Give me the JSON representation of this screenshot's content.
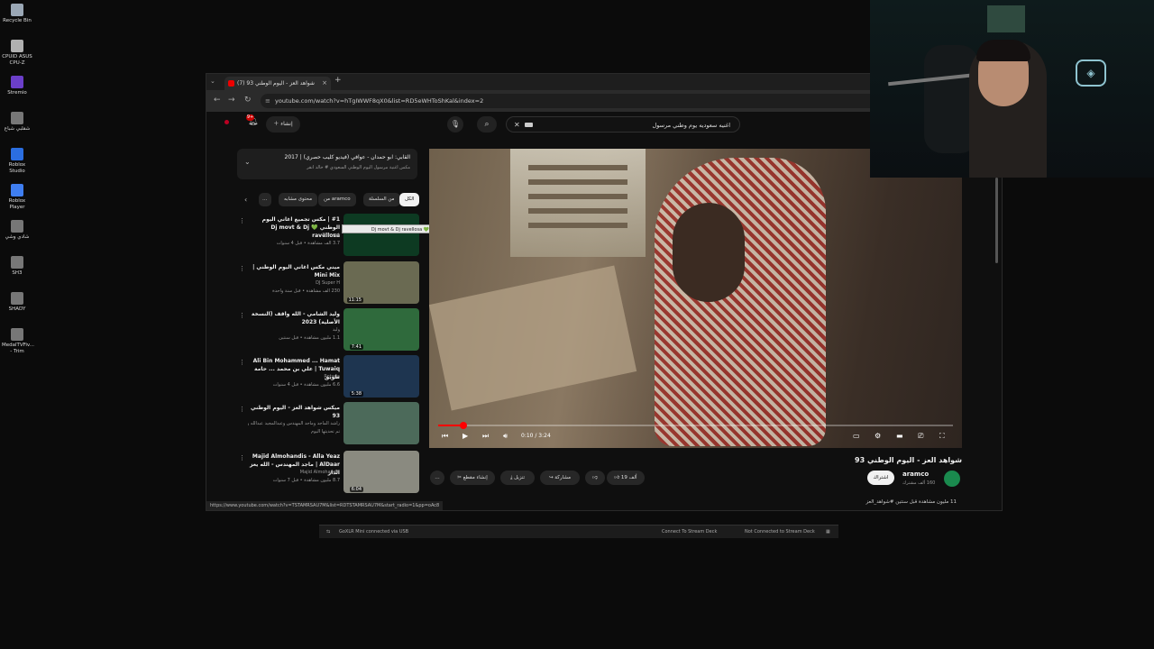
{
  "desktop": {
    "icons": [
      {
        "label": "Recycle Bin",
        "color": "#9aa7b5"
      },
      {
        "label": "CPUID ASUS CPU-Z",
        "color": "#b0b0b0"
      },
      {
        "label": "Stremio",
        "color": "#6b3fc9"
      },
      {
        "label": "شقلبي شباع",
        "color": "#777777"
      },
      {
        "label": "Roblox Studio",
        "color": "#2b6ee0"
      },
      {
        "label": "Roblox Player",
        "color": "#3f7ef0"
      },
      {
        "label": "شادي وشي",
        "color": "#777777"
      },
      {
        "label": "SH3",
        "color": "#777777"
      },
      {
        "label": "SHADY",
        "color": "#777777"
      },
      {
        "label": "MedalTVFiv... - Trim",
        "color": "#777777"
      }
    ]
  },
  "browser": {
    "tab_title": "(7) شواهد العز - اليوم الوطني 93",
    "url": "youtube.com/watch?v=hTgIWWF8qX0&list=RD5eWHToShKal&index=2",
    "status_url": "https://www.youtube.com/watch?v=TSTAMRSAU7M&list=RDTSTAMRSAU7M&start_radio=1&pp=oAc8"
  },
  "youtube": {
    "search_query": "اغنيه سعوديه يوم وطني مرسول",
    "create_label": "إنشاء",
    "notification_count": "9+",
    "playlist": {
      "title": "القابي: ابو حمدان - عوافي (فيديو كليب حصري) | 2017",
      "subtitle": "مكس اغنية مرسول اليوم الوطني السعودي # خالد انقر"
    },
    "chips": [
      "الكل",
      "من السلسلة",
      "من aramco",
      "محتوى مشابه"
    ],
    "tooltip": "#1 | مكس تجميع اغاني اليوم الوطني 💚 Dj movt & Dj ravellosa",
    "related": [
      {
        "title": "#1 | مكس تجميع اغاني اليوم الوطني 💚 Dj movt & Dj ravellosa",
        "channel": "Dj movt",
        "meta": "3.7 ألف مشاهدة • قبل 4 سنوات",
        "duration": "",
        "color": "#0d3a22"
      },
      {
        "title": "ميني مكس اغاني اليوم الوطني | Mini Mix",
        "channel": "DJ Super H",
        "meta": "230 ألف مشاهدة • قبل سنة واحدة",
        "duration": "11:15",
        "color": "#6a6a52"
      },
      {
        "title": "وليد الشامي - الله واقف (النسخة الأصلية) 2023",
        "channel": "وليد",
        "meta": "1.1 مليون مشاهدة • قبل سنتين",
        "duration": "7:41",
        "color": "#2f6a3c"
      },
      {
        "title": "Ali Bin Mohammed ... Hamat Tuwaiq | علي بن محمد ... حامة طويق",
        "channel": "Rotana",
        "meta": "6.6 مليون مشاهدة • قبل 4 سنوات",
        "duration": "5:38",
        "color": "#1e3550"
      },
      {
        "title": "ميكس شواهد العز - اليوم الوطني 93",
        "channel": "راشد الماجد وماجد المهندس وعبدالمجيد عبدالله والشيوخ وشاوشان ...",
        "meta": "تم تحديثها اليوم",
        "duration": "",
        "color": "#4c6a5a"
      },
      {
        "title": "Majid Almohandis - Alla Yeaz AlDaar | ماجد المهندس - الله يعز الدار",
        "channel": "Majid Almohandis",
        "meta": "8.7 مليون مشاهدة • قبل 7 سنوات",
        "duration": "6:04",
        "color": "#8a8a80"
      }
    ],
    "player": {
      "time": "0:10 / 3:24",
      "progress_fraction": 0.049
    },
    "video": {
      "title": "شواهد العز - اليوم الوطني 93",
      "channel": "aramco",
      "subscribers": "160 ألف مشترك",
      "subscribe_label": "اشتراك",
      "likes": "19 ألف",
      "share_label": "مشاركة",
      "download_label": "تنزيل",
      "clip_label": "إنشاء مقطع",
      "description": "11 مليون مشاهدة  قبل سنتين  #شواهد_العز"
    }
  },
  "goxlr": {
    "left": "GoXLR Mini connected via USB",
    "center": "Connect To Stream Deck",
    "right": "Not Connected to Stream Deck"
  }
}
